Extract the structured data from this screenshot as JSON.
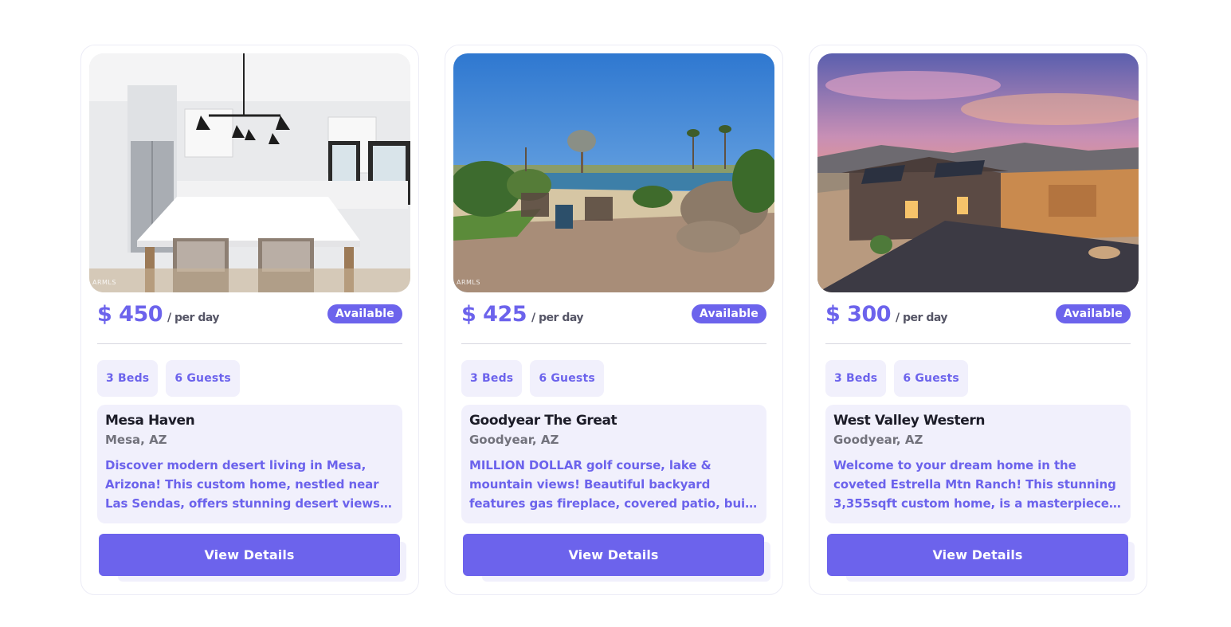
{
  "listings": [
    {
      "price": "$ 450",
      "price_unit": "/ per day",
      "status": "Available",
      "beds": "3 Beds",
      "guests": "6 Guests",
      "name": "Mesa Haven",
      "location": "Mesa, AZ",
      "description": "Discover modern desert living in Mesa, Arizona! This custom home, nestled near Las Sendas, offers stunning desert views. The home features an open floor plan.",
      "button_label": "View Details",
      "photo_watermark": "ARMLS",
      "photo_subject": "kitchen-interior"
    },
    {
      "price": "$ 425",
      "price_unit": "/ per day",
      "status": "Available",
      "beds": "3 Beds",
      "guests": "6 Guests",
      "name": "Goodyear The Great",
      "location": "Goodyear, AZ",
      "description": "MILLION DOLLAR golf course, lake & mountain views! Beautiful backyard features gas fireplace, covered patio, built in BBQ & rock waterfall feature.",
      "button_label": "View Details",
      "photo_watermark": "ARMLS",
      "photo_subject": "backyard-lake-patio"
    },
    {
      "price": "$ 300",
      "price_unit": "/ per day",
      "status": "Available",
      "beds": "3 Beds",
      "guests": "6 Guests",
      "name": "West Valley Western",
      "location": "Goodyear, AZ",
      "description": "Welcome to your dream home in the coveted Estrella Mtn Ranch! This stunning 3,355sqft custom home, is a masterpiece of design and comfort.",
      "button_label": "View Details",
      "photo_watermark": "",
      "photo_subject": "house-exterior-sunset"
    }
  ],
  "colors": {
    "accent": "#6c63ec",
    "tag_bg": "#f1f0fc",
    "title": "#1c1c28",
    "muted": "#72727c"
  }
}
